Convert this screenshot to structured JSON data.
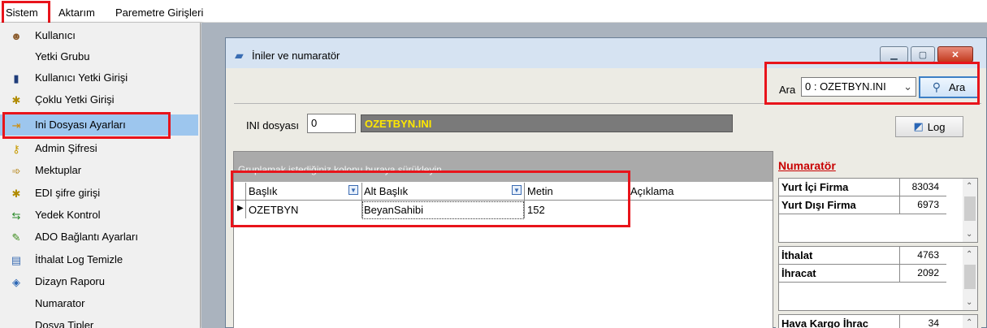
{
  "menu": {
    "items": [
      "Sistem",
      "Aktarım",
      "Paremetre Girişleri"
    ]
  },
  "dropdown": {
    "items": [
      {
        "label": "Kullanıcı",
        "icon": "user-icon"
      },
      {
        "label": "Yetki Grubu",
        "icon": ""
      },
      {
        "label": "Kullanıcı Yetki Girişi",
        "icon": "person-icon"
      },
      {
        "label": "Çoklu Yetki Girişi",
        "icon": "keys-icon"
      },
      {
        "label": "Ini Dosyası  Ayarları",
        "icon": "settings-file-icon"
      },
      {
        "label": "Admin Şifresi",
        "icon": "key-icon"
      },
      {
        "label": "Mektuplar",
        "icon": "mail-icon"
      },
      {
        "label": "EDI şifre girişi",
        "icon": "keys-icon"
      },
      {
        "label": "Yedek Kontrol",
        "icon": "backup-icon"
      },
      {
        "label": "ADO Bağlantı Ayarları",
        "icon": "connection-icon"
      },
      {
        "label": "İthalat Log Temizle",
        "icon": "log-clean-icon"
      },
      {
        "label": "Dizayn Raporu",
        "icon": "report-icon"
      },
      {
        "label": "Numarator",
        "icon": ""
      },
      {
        "label": "Dosya Tipler",
        "icon": ""
      }
    ]
  },
  "window": {
    "title": "İniler ve numaratör",
    "search_label": "Ara",
    "search_value": "0 : OZETBYN.INI",
    "search_button": "Ara",
    "ini_label": "INI dosyası",
    "ini_value": "0",
    "ini_name": "OZETBYN.INI",
    "log_button": "Log"
  },
  "grid": {
    "group_hint": "Gruplamak istediğiniz kolonu buraya sürükleyin",
    "columns": [
      "Başlık",
      "Alt Başlık",
      "Metin",
      "Açıklama"
    ],
    "rows": [
      [
        "OZETBYN",
        "BeyanSahibi",
        "152",
        ""
      ]
    ]
  },
  "numerator": {
    "title": "Numaratör",
    "box1": [
      {
        "label": "Yurt İçi Firma",
        "value": "83034"
      },
      {
        "label": "Yurt Dışı Firma",
        "value": "6973"
      }
    ],
    "box2": [
      {
        "label": "İthalat",
        "value": "4763"
      },
      {
        "label": "İhracat",
        "value": "2092"
      }
    ],
    "box3": [
      {
        "label": "Hava Kargo İhrac",
        "value": "34"
      }
    ]
  }
}
